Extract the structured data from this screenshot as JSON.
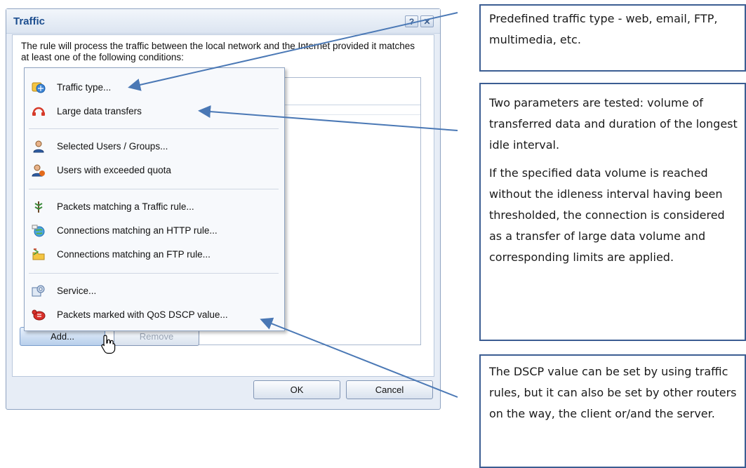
{
  "dialog": {
    "title": "Traffic",
    "help_label": "?",
    "close_label": "✕",
    "description": "The rule will process the traffic between the local network and the Internet provided it matches at least one of the following conditions:",
    "add_label": "Add...",
    "remove_label": "Remove",
    "ok_label": "OK",
    "cancel_label": "Cancel"
  },
  "menu": {
    "items": [
      {
        "label": "Traffic type...",
        "icon": "traffic-type-icon"
      },
      {
        "label": "Large data transfers",
        "icon": "large-data-icon"
      },
      {
        "label": "Selected Users / Groups...",
        "icon": "user-icon"
      },
      {
        "label": "Users with exceeded quota",
        "icon": "quota-user-icon"
      },
      {
        "label": "Packets matching a Traffic rule...",
        "icon": "traffic-rule-icon"
      },
      {
        "label": "Connections matching an HTTP rule...",
        "icon": "http-rule-icon"
      },
      {
        "label": "Connections matching an FTP rule...",
        "icon": "ftp-rule-icon"
      },
      {
        "label": "Service...",
        "icon": "service-icon"
      },
      {
        "label": "Packets marked with QoS DSCP value...",
        "icon": "dscp-icon"
      }
    ]
  },
  "callouts": {
    "traffic_type": "Predefined traffic type - web, email, FTP, multimedia, etc.",
    "large_data_p1": "Two parameters are tested: volume of transferred data and duration of the longest idle interval.",
    "large_data_p2": "If the specified data volume is reached without the idleness interval having been thresholded, the connection is considered as a transfer of large data volume and corresponding limits are applied.",
    "dscp": "The DSCP value can be set by using traffic rules, but it can also be set by other routers on the way, the client or/and the server."
  },
  "colors": {
    "title_blue": "#1d4e8f",
    "callout_border": "#3b5d92",
    "arrow": "#4a78b5"
  }
}
